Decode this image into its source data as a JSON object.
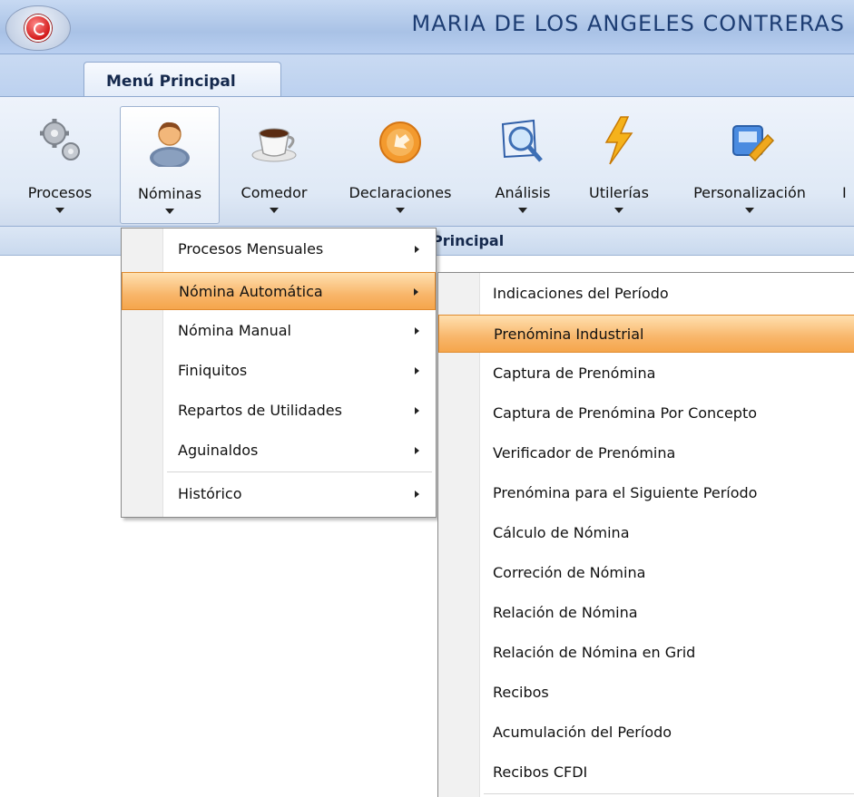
{
  "window": {
    "title": "MARIA DE LOS ANGELES CONTRERAS"
  },
  "ribbon": {
    "tab_label": "Menú Principal",
    "buttons": [
      {
        "label": "Procesos",
        "icon": "gears-icon"
      },
      {
        "label": "Nóminas",
        "icon": "person-icon"
      },
      {
        "label": "Comedor",
        "icon": "coffee-cup-icon"
      },
      {
        "label": "Declaraciones",
        "icon": "orange-arrow-icon"
      },
      {
        "label": "Análisis",
        "icon": "magnifier-document-icon"
      },
      {
        "label": "Utilerías",
        "icon": "lightning-icon"
      },
      {
        "label": "Personalización",
        "icon": "settings-tools-icon"
      },
      {
        "label": "I",
        "icon": "truncated-icon"
      }
    ],
    "section_caption": "Principal"
  },
  "nominas_menu": {
    "items": [
      {
        "label": "Procesos Mensuales"
      },
      {
        "label": "Nómina Automática"
      },
      {
        "label": "Nómina Manual"
      },
      {
        "label": "Finiquitos"
      },
      {
        "label": "Repartos de Utilidades"
      },
      {
        "label": "Aguinaldos"
      },
      {
        "label": "Histórico"
      }
    ]
  },
  "automatica_submenu": {
    "items": [
      {
        "label": "Indicaciones del Período"
      },
      {
        "label": "Prenómina Industrial"
      },
      {
        "label": "Captura de Prenómina"
      },
      {
        "label": "Captura de Prenómina Por Concepto"
      },
      {
        "label": "Verificador de Prenómina"
      },
      {
        "label": "Prenómina para el Siguiente Período"
      },
      {
        "label": "Cálculo de Nómina"
      },
      {
        "label": "Correción de Nómina"
      },
      {
        "label": "Relación de Nómina"
      },
      {
        "label": "Relación de Nómina en Grid"
      },
      {
        "label": "Recibos"
      },
      {
        "label": "Acumulación del Período"
      },
      {
        "label": "Recibos CFDI"
      }
    ]
  },
  "colors": {
    "highlight": "#f7b260",
    "ribbon_bg": "#dfe9f6",
    "title_text": "#1d3d73"
  }
}
